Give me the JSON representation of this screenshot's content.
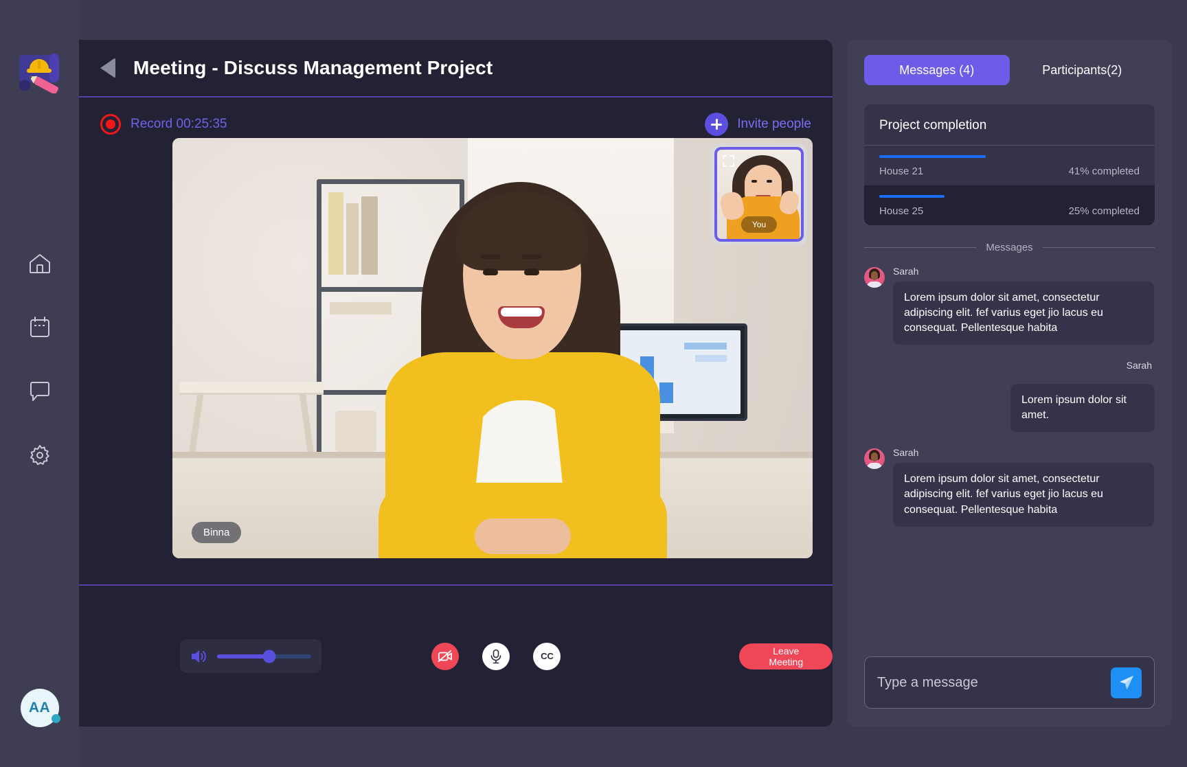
{
  "sidebar": {
    "logo_name": "blueprint-hardhat-logo",
    "items": [
      {
        "icon": "home-icon",
        "label": "Home"
      },
      {
        "icon": "calendar-icon",
        "label": "Calendar"
      },
      {
        "icon": "chat-icon",
        "label": "Messages"
      },
      {
        "icon": "gear-icon",
        "label": "Settings"
      }
    ],
    "avatar": {
      "initials": "AA",
      "status_color": "#2ca9c4"
    }
  },
  "header": {
    "back_icon": "back-triangle-icon",
    "title": "Meeting - Discuss Management Project"
  },
  "subbar": {
    "record_icon": "record-icon",
    "record_label": "Record 00:25:35",
    "invite_icon": "plus-circle-icon",
    "invite_label": "Invite people"
  },
  "video": {
    "main_speaker_name": "Binna",
    "self_view": {
      "label": "You",
      "expand_icon": "expand-icon"
    }
  },
  "controls": {
    "volume_icon": "speaker-volume-icon",
    "volume_percent": 55,
    "camera_button": {
      "icon": "camera-off-icon",
      "state": "off",
      "color": "#ef4757"
    },
    "mic_button": {
      "icon": "microphone-icon",
      "state": "on",
      "color": "#ffffff"
    },
    "cc_button": {
      "icon": "closed-caption-icon",
      "label": "CC"
    },
    "leave_label": "Leave Meeting",
    "leave_color": "#ef4757"
  },
  "chat": {
    "tabs": [
      {
        "label": "Messages (4)",
        "active": true
      },
      {
        "label": "Participants(2)",
        "active": false
      }
    ],
    "project": {
      "title": "Project completion",
      "rows": [
        {
          "name": "House 21",
          "percent": 41,
          "percent_label": "41% completed"
        },
        {
          "name": "House 25",
          "percent": 25,
          "percent_label": "25% completed"
        }
      ],
      "bar_color": "#1a6ef5"
    },
    "messages_divider_label": "Messages",
    "messages": [
      {
        "sender": "Sarah",
        "text": "Lorem ipsum dolor sit amet, consectetur adipiscing elit. fef varius eget jio lacus eu consequat. Pellentesque habita",
        "direction": "in"
      },
      {
        "sender": "Sarah",
        "text": "Lorem ipsum dolor sit amet.",
        "direction": "out"
      },
      {
        "sender": "Sarah",
        "text": "Lorem ipsum dolor sit amet, consectetur adipiscing elit. fef varius eget jio lacus eu consequat. Pellentesque habita",
        "direction": "in"
      }
    ],
    "composer": {
      "placeholder": "Type a message",
      "value": "",
      "send_icon": "send-paper-plane-icon",
      "send_color": "#1d8ff5"
    }
  }
}
